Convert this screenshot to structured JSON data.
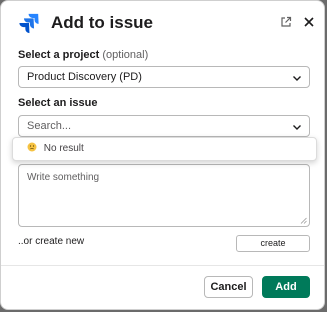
{
  "dialog": {
    "title": "Add to issue"
  },
  "project": {
    "label": "Select a project",
    "optional": "(optional)",
    "value": "Product Discovery (PD)"
  },
  "issue": {
    "label": "Select an issue",
    "placeholder": "Search...",
    "no_result": "No result"
  },
  "comment": {
    "placeholder": "Write something"
  },
  "create": {
    "text": "..or create new",
    "button": "create"
  },
  "footer": {
    "cancel": "Cancel",
    "add": "Add"
  },
  "colors": {
    "primary": "#007a5a",
    "logo": "#2684ff"
  }
}
